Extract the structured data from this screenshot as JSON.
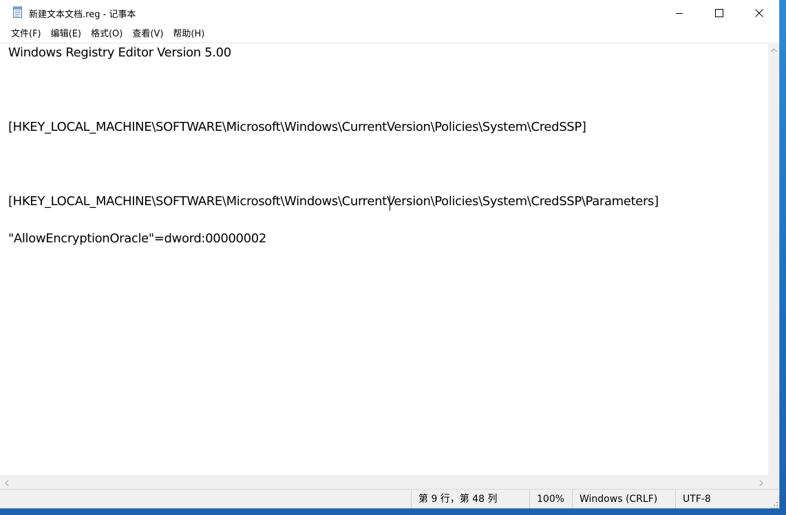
{
  "window": {
    "title": "新建文本文档.reg - 记事本",
    "app_icon": "notepad-icon",
    "controls": {
      "minimize_icon": "minimize-icon",
      "maximize_icon": "maximize-icon",
      "close_icon": "close-icon"
    }
  },
  "menu": {
    "items": [
      {
        "label": "文件(F)",
        "name": "file"
      },
      {
        "label": "编辑(E)",
        "name": "edit"
      },
      {
        "label": "格式(O)",
        "name": "format"
      },
      {
        "label": "查看(V)",
        "name": "view"
      },
      {
        "label": "帮助(H)",
        "name": "help"
      }
    ]
  },
  "editor": {
    "lines": [
      "Windows Registry Editor Version 5.00",
      "",
      "",
      "",
      "[HKEY_LOCAL_MACHINE\\SOFTWARE\\Microsoft\\Windows\\CurrentVersion\\Policies\\System\\CredSSP]",
      "",
      "",
      "",
      "[HKEY_LOCAL_MACHINE\\SOFTWARE\\Microsoft\\Windows\\CurrentVersion\\Policies\\System\\CredSSP\\Parameters]",
      "",
      "\"AllowEncryptionOracle\"=dword:00000002"
    ],
    "caret": {
      "line": 9,
      "column": 48
    }
  },
  "statusbar": {
    "position": "第 9 行，第 48 列",
    "zoom": "100%",
    "line_ending": "Windows (CRLF)",
    "encoding": "UTF-8"
  },
  "colors": {
    "desktop": "#1c6fc2",
    "window_bg": "#ffffff",
    "chrome_bg": "#f0f0f0",
    "text": "#000000"
  }
}
